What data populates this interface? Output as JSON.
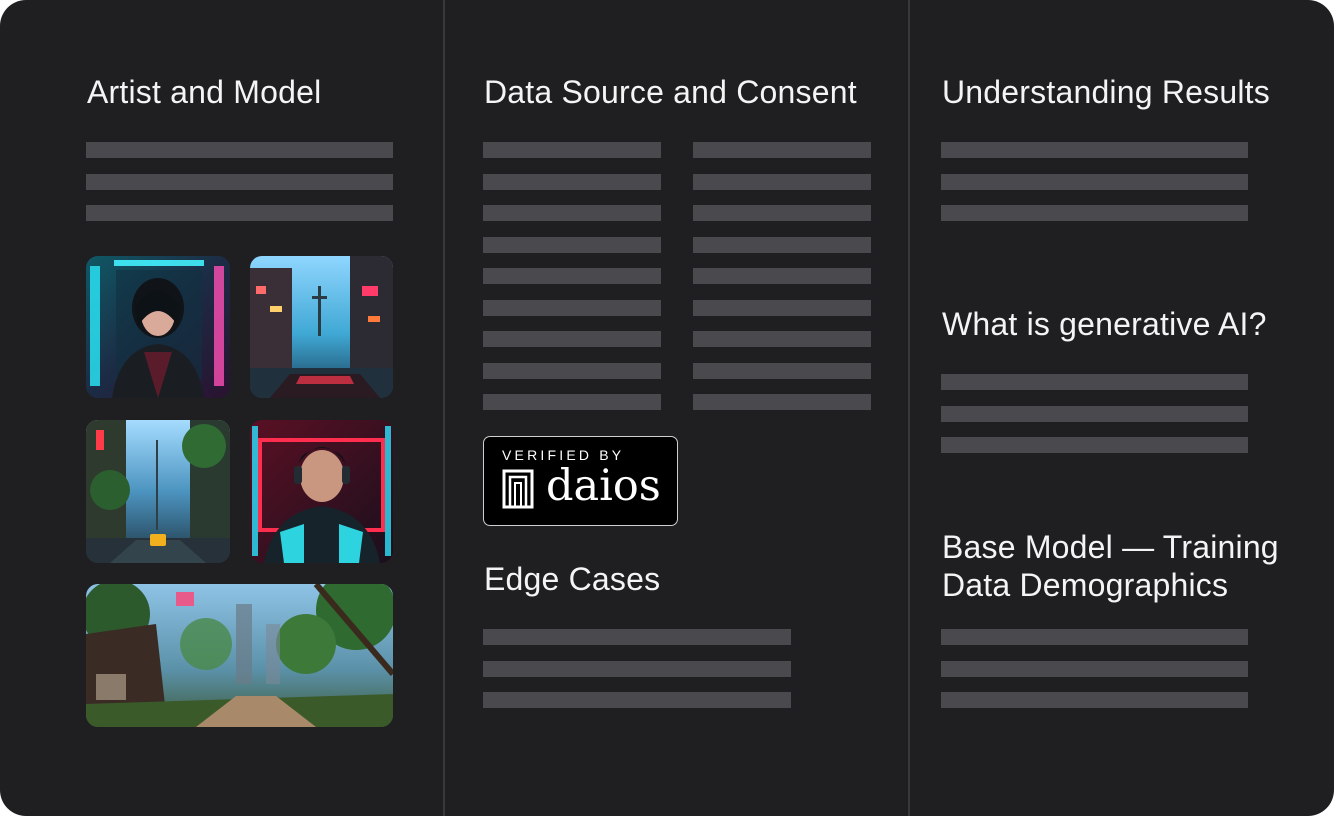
{
  "columns": {
    "left": {
      "heading": "Artist and Model"
    },
    "middle": {
      "heading": "Data Source and Consent",
      "badge": {
        "top_text": "VERIFIED BY",
        "brand": "daios"
      },
      "edge_heading": "Edge Cases"
    },
    "right": {
      "heading_1": "Understanding Results",
      "heading_2": "What is generative AI?",
      "heading_3_line1": "Base Model — Training",
      "heading_3_line2": "Data Demographics"
    }
  },
  "images": [
    {
      "name": "cyberpunk-woman-portrait"
    },
    {
      "name": "neon-city-street-with-cross"
    },
    {
      "name": "neon-jungle-street-with-taxi"
    },
    {
      "name": "cyberpunk-man-with-headphones"
    },
    {
      "name": "overgrown-village-forest-path"
    }
  ],
  "colors": {
    "background": "#1f1f22",
    "placeholder_bar": "#4a4a4e",
    "divider": "#38383c",
    "text": "#f4f4f4"
  }
}
